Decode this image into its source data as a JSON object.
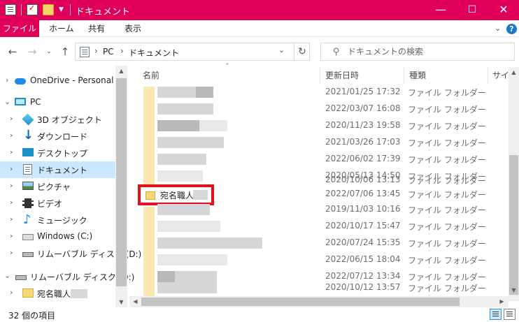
{
  "window": {
    "title": "ドキュメント",
    "controls": {
      "minimize": "—",
      "maximize": "☐",
      "close": "✕"
    }
  },
  "ribbon": {
    "tabs": [
      "ファイル",
      "ホーム",
      "共有",
      "表示"
    ],
    "expand_icon": "chevron-down-icon",
    "help": "?"
  },
  "address": {
    "breadcrumb": [
      "PC",
      "ドキュメント"
    ],
    "separator": "›"
  },
  "search": {
    "placeholder": "ドキュメントの検索"
  },
  "nav": {
    "items": [
      {
        "label": "OneDrive - Personal",
        "icon": "onedrive-icon"
      },
      {
        "label": "PC",
        "icon": "pc-icon"
      },
      {
        "label": "3D オブジェクト",
        "icon": "3d-objects-icon"
      },
      {
        "label": "ダウンロード",
        "icon": "download-icon"
      },
      {
        "label": "デスクトップ",
        "icon": "desktop-icon"
      },
      {
        "label": "ドキュメント",
        "icon": "documents-icon",
        "selected": true
      },
      {
        "label": "ピクチャ",
        "icon": "pictures-icon"
      },
      {
        "label": "ビデオ",
        "icon": "videos-icon"
      },
      {
        "label": "ミュージック",
        "icon": "music-icon"
      },
      {
        "label": "Windows (C:)",
        "icon": "drive-icon"
      },
      {
        "label": "リムーバブル ディスク (D:)",
        "icon": "removable-disk-icon"
      },
      {
        "label": "リムーバブル ディスク (D:)",
        "icon": "removable-disk-icon"
      },
      {
        "label": "宛名職人",
        "icon": "folder-icon"
      }
    ]
  },
  "columns": {
    "name": "名前",
    "modified": "更新日時",
    "type": "種類",
    "size": "サイズ"
  },
  "files": [
    {
      "modified": "2021/01/25 17:32",
      "type": "ファイル フォルダー"
    },
    {
      "modified": "2022/03/07 16:08",
      "type": "ファイル フォルダー"
    },
    {
      "modified": "2020/11/23 19:58",
      "type": "ファイル フォルダー"
    },
    {
      "modified": "2021/03/26 17:03",
      "type": "ファイル フォルダー"
    },
    {
      "modified": "2022/06/02 17:39",
      "type": "ファイル フォルダー"
    },
    {
      "modified": "2020/05/13 14:50",
      "type": "ファイル フォルダー"
    },
    {
      "modified": "2020/10/06 13:13",
      "type": "ファイル フォルダー"
    },
    {
      "name": "宛名職人",
      "modified": "2022/07/06 13:45",
      "type": "ファイル フォルダー",
      "highlighted": true
    },
    {
      "modified": "2019/11/03 10:16",
      "type": "ファイル フォルダー"
    },
    {
      "modified": "2020/10/17 15:47",
      "type": "ファイル フォルダー"
    },
    {
      "modified": "2020/07/24 15:35",
      "type": "ファイル フォルダー"
    },
    {
      "modified": "2022/06/15 18:04",
      "type": "ファイル フォルダー"
    },
    {
      "modified": "2022/07/12 13:34",
      "type": "ファイル フォルダー"
    },
    {
      "modified": "2020/10/12 13:57",
      "type": "ファイル フォルダー"
    }
  ],
  "status": {
    "count": "32 個の項目"
  },
  "colors": {
    "accent": "#e0005a",
    "selection": "#cce8ff",
    "highlight_box": "#e30f1f"
  }
}
